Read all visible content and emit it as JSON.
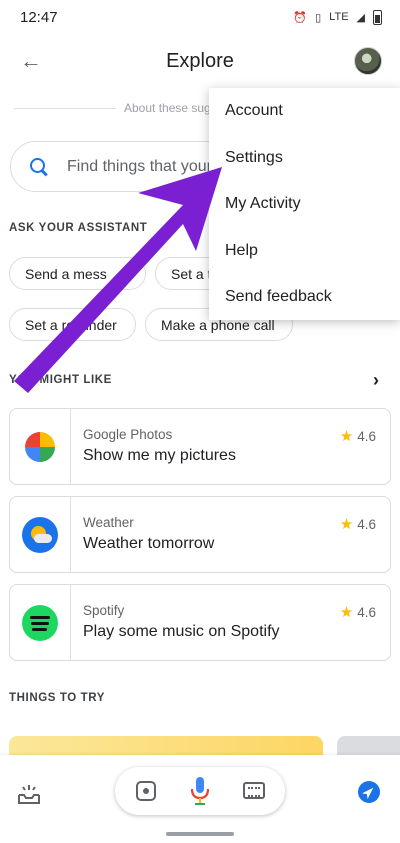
{
  "status_bar": {
    "time": "12:47",
    "icons": [
      "alarm-icon",
      "vibrate-icon",
      "lte-icon",
      "signal-icon",
      "battery-icon"
    ],
    "lte": "LTE"
  },
  "app_bar": {
    "title": "Explore",
    "back_icon": "arrow-back-icon",
    "avatar_icon": "account-avatar"
  },
  "about_text": "About these sug",
  "search": {
    "placeholder": "Find things that your"
  },
  "sections": {
    "ask": "ASK YOUR ASSISTANT",
    "like": "YOU MIGHT LIKE",
    "try": "THINGS TO TRY"
  },
  "chips": [
    "Send a mess",
    "Set a t",
    "Set a reminder",
    "Make a phone call"
  ],
  "suggestions": [
    {
      "app": "Google Photos",
      "action": "Show me my pictures",
      "rating": "4.6",
      "icon": "google-photos-icon"
    },
    {
      "app": "Weather",
      "action": "Weather tomorrow",
      "rating": "4.6",
      "icon": "weather-icon"
    },
    {
      "app": "Spotify",
      "action": "Play some music on Spotify",
      "rating": "4.6",
      "icon": "spotify-icon"
    }
  ],
  "menu": {
    "items": [
      "Account",
      "Settings",
      "My Activity",
      "Help",
      "Send feedback"
    ]
  },
  "bottom_bar": {
    "icons": [
      "snapshot-icon",
      "lens-icon",
      "microphone-icon",
      "keyboard-icon",
      "compass-icon"
    ]
  },
  "colors": {
    "accent_blue": "#1a73e8",
    "star_yellow": "#fbbc04",
    "annotation_purple": "#7a1fd1"
  }
}
